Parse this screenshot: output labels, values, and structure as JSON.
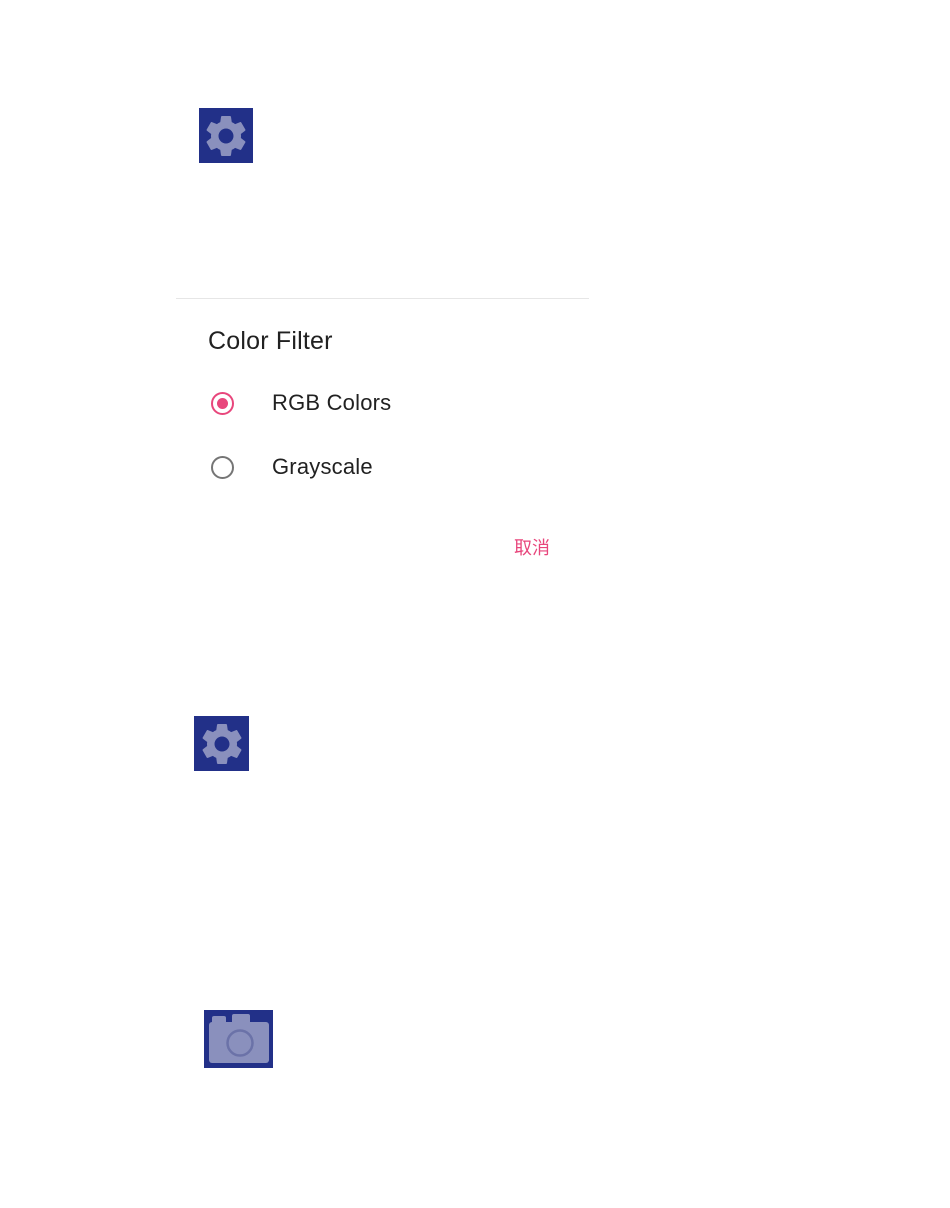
{
  "icons": {
    "top": "gear-icon",
    "middle": "gear-icon",
    "bottom": "camera-icon"
  },
  "colors": {
    "icon_tile_background": "#223088",
    "icon_glyph": "#8a90bd",
    "accent": "#e8467c",
    "text_primary": "#212121",
    "radio_unchecked": "#757575"
  },
  "dialog": {
    "title": "Color Filter",
    "options": [
      {
        "label": "RGB Colors",
        "selected": true
      },
      {
        "label": "Grayscale",
        "selected": false
      }
    ],
    "cancel_label": "取消"
  }
}
